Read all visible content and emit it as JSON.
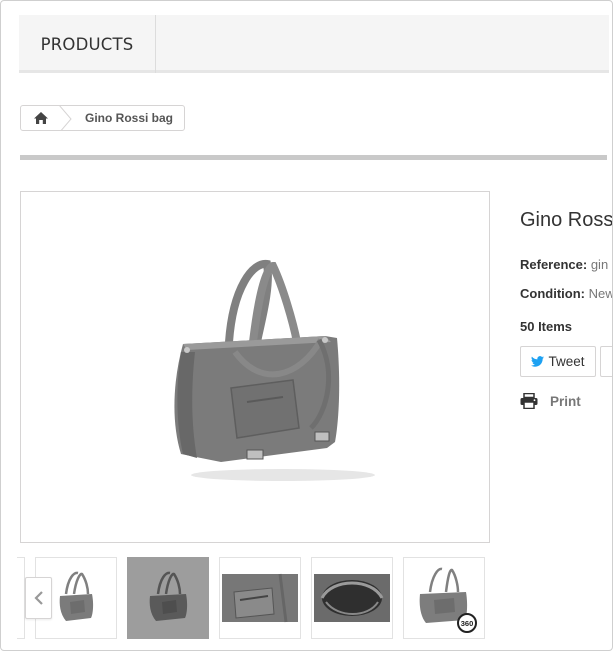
{
  "nav": {
    "products_label": "PRODUCTS"
  },
  "breadcrumb": {
    "home_icon": "home-icon",
    "current": "Gino Rossi bag"
  },
  "product": {
    "title": "Gino Rossi bag",
    "reference_label": "Reference:",
    "reference_value": "gin",
    "condition_label": "Condition:",
    "condition_value": "New",
    "quantity": "50 Items"
  },
  "share": {
    "tweet_label": "Tweet",
    "print_label": "Print"
  },
  "thumbnails": {
    "count": 5,
    "active_index": 1,
    "badge": "360"
  },
  "colors": {
    "bag": "#7b7b7b",
    "twitter": "#1da1f2",
    "active_thumb": "#9d9d9d"
  }
}
